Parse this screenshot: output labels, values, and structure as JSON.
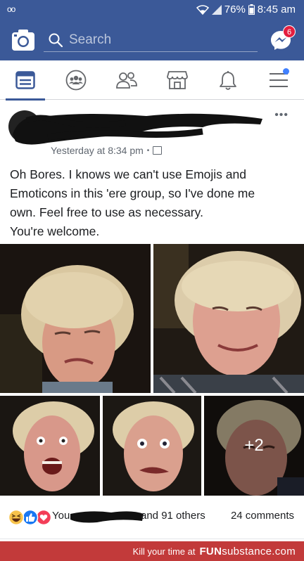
{
  "status_bar": {
    "left_icon": "voicemail-icon",
    "battery": "76%",
    "time": "8:45 am"
  },
  "header": {
    "search_placeholder": "Search",
    "messenger_badge": "6",
    "colors": {
      "brand": "#3b5998",
      "badge": "#e41e3f"
    }
  },
  "tabs": [
    {
      "icon": "news-feed-icon",
      "active": true
    },
    {
      "icon": "groups-icon"
    },
    {
      "icon": "friends-icon"
    },
    {
      "icon": "marketplace-icon"
    },
    {
      "icon": "notifications-bell-icon"
    },
    {
      "icon": "menu-icon",
      "has_dot": true
    }
  ],
  "post": {
    "timestamp": "Yesterday at 8:34 pm",
    "separator": "•",
    "text_lines": [
      "Oh Bores. I knows we can't use Emojis and",
      "Emoticons in this 'ere group, so I've done me",
      "own. Feel free to use as necessary.",
      "You're welcome."
    ],
    "photos_extra": "+2",
    "reactions": {
      "icons": [
        "haha-icon",
        "like-icon",
        "love-icon"
      ],
      "you_label": "You",
      "others_label": "and 91 others",
      "comments_label": "24 comments"
    }
  },
  "watermark": {
    "prefix": "Kill your time at",
    "brand_bold": "FUN",
    "brand_rest": "substance.com"
  }
}
